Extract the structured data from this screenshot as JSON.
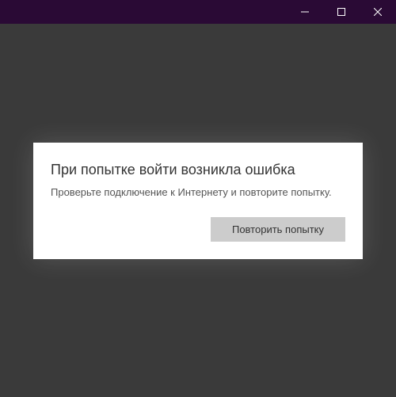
{
  "dialog": {
    "title": "При попытке войти возникла ошибка",
    "message": "Проверьте подключение к Интернету и повторите попытку.",
    "retry_label": "Повторить попытку"
  }
}
